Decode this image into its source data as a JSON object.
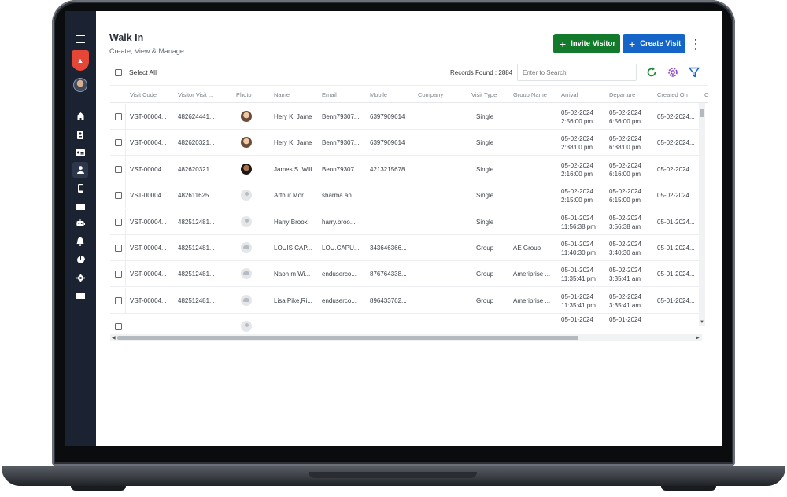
{
  "header": {
    "title": "Walk In",
    "subtitle": "Create, View & Manage",
    "invite_label": "Invite Visitor",
    "create_label": "Create Visit"
  },
  "toolbar": {
    "select_all_label": "Select All",
    "records_label": "Records Found : 2884",
    "search_placeholder": "Enter to Search"
  },
  "colors": {
    "invite_button": "#127a2a",
    "create_button": "#1565c9",
    "sidebar_bg": "#1b2333",
    "refresh_icon": "#1c8a36",
    "settings_icon": "#8e44c9",
    "filter_icon": "#1565c9"
  },
  "sidebar": {
    "icons": [
      "menu-icon",
      "logo-shield",
      "user-avatar",
      "home-icon",
      "badge-icon",
      "id-card-icon",
      "person-icon",
      "mobile-icon",
      "folder-icon",
      "robot-icon",
      "bell-icon",
      "pie-chart-icon",
      "gear-icon",
      "folder-icon"
    ]
  },
  "table": {
    "columns": [
      "Visit Code",
      "Visitor Visit ...",
      "Photo",
      "Name",
      "Email",
      "Mobile",
      "Company",
      "Visit Type",
      "Group Name",
      "Arrival",
      "Departure",
      "Created On",
      "C"
    ],
    "rows": [
      {
        "code": "VST-00004...",
        "visit": "482624441...",
        "photo": "photo-1",
        "name": "Hery K. Jame",
        "email": "Benn79307...",
        "mobile": "6397909614",
        "company": "",
        "type": "Single",
        "group": "",
        "arr_d": "05-02-2024",
        "arr_t": "2:56:00 pm",
        "dep_d": "05-02-2024",
        "dep_t": "6:56:00 pm",
        "created": "05-02-2024..."
      },
      {
        "code": "VST-00004...",
        "visit": "482620321...",
        "photo": "photo-1",
        "name": "Hery K. Jame",
        "email": "Benn79307...",
        "mobile": "6397909614",
        "company": "",
        "type": "Single",
        "group": "",
        "arr_d": "05-02-2024",
        "arr_t": "2:38:00 pm",
        "dep_d": "05-02-2024",
        "dep_t": "6:38:00 pm",
        "created": "05-02-2024..."
      },
      {
        "code": "VST-00004...",
        "visit": "482620321...",
        "photo": "photo-2",
        "name": "James S. Will",
        "email": "Benn79307...",
        "mobile": "4213215678",
        "company": "",
        "type": "Single",
        "group": "",
        "arr_d": "05-02-2024",
        "arr_t": "2:16:00 pm",
        "dep_d": "05-02-2024",
        "dep_t": "6:16:00 pm",
        "created": "05-02-2024..."
      },
      {
        "code": "VST-00004...",
        "visit": "482611625...",
        "photo": "default",
        "name": "Arthur Mor...",
        "email": "sharma.an...",
        "mobile": "",
        "company": "",
        "type": "Single",
        "group": "",
        "arr_d": "05-02-2024",
        "arr_t": "2:15:00 pm",
        "dep_d": "05-02-2024",
        "dep_t": "6:15:00 pm",
        "created": "05-02-2024..."
      },
      {
        "code": "VST-00004...",
        "visit": "482512481...",
        "photo": "default",
        "name": "Harry Brook",
        "email": "harry.broo...",
        "mobile": "",
        "company": "",
        "type": "Single",
        "group": "",
        "arr_d": "05-01-2024",
        "arr_t": "11:56:38 pm",
        "dep_d": "05-02-2024",
        "dep_t": "3:56:38 am",
        "created": "05-01-2024..."
      },
      {
        "code": "VST-00004...",
        "visit": "482512481...",
        "photo": "group",
        "name": "LOUIS CAP...",
        "email": "LOU.CAPU...",
        "mobile": "343646366...",
        "company": "",
        "type": "Group",
        "group": "AE Group",
        "arr_d": "05-01-2024",
        "arr_t": "11:40:30 pm",
        "dep_d": "05-02-2024",
        "dep_t": "3:40:30 am",
        "created": "05-01-2024..."
      },
      {
        "code": "VST-00004...",
        "visit": "482512481...",
        "photo": "group",
        "name": "Naoh m Wi...",
        "email": "enduserco...",
        "mobile": "876764338...",
        "company": "",
        "type": "Group",
        "group": "Ameriprise ...",
        "arr_d": "05-01-2024",
        "arr_t": "11:35:41 pm",
        "dep_d": "05-02-2024",
        "dep_t": "3:35:41 am",
        "created": "05-01-2024..."
      },
      {
        "code": "VST-00004...",
        "visit": "482512481...",
        "photo": "group",
        "name": "Lisa Pike,Ri...",
        "email": "enduserco...",
        "mobile": "896433762...",
        "company": "",
        "type": "Group",
        "group": "Ameriprise ...",
        "arr_d": "05-01-2024",
        "arr_t": "11:35:41 pm",
        "dep_d": "05-02-2024",
        "dep_t": "3:35:41 am",
        "created": "05-01-2024..."
      }
    ],
    "partial_row": {
      "arr_d": "05-01-2024",
      "dep_d": "05-01-2024"
    }
  }
}
